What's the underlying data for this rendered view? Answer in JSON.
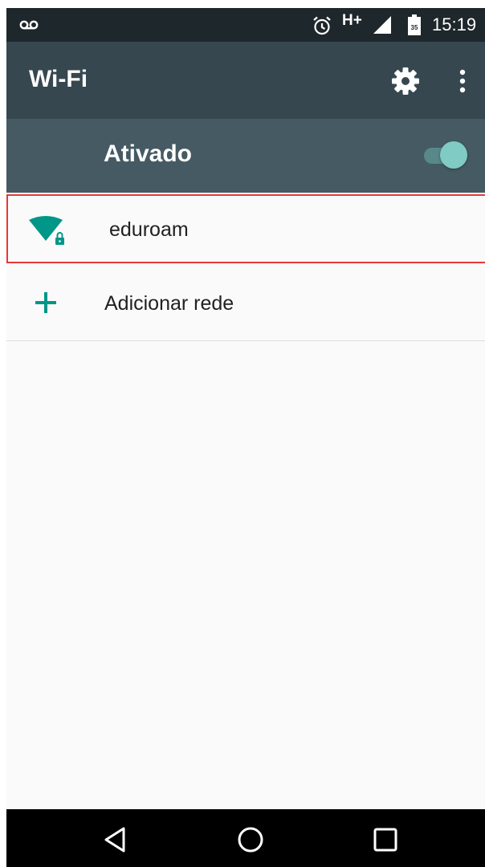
{
  "status_bar": {
    "network": "H+",
    "battery_level": "35",
    "time": "15:19",
    "icons": [
      "voicemail-icon",
      "alarm-icon",
      "signal-icon",
      "battery-icon"
    ]
  },
  "app_bar": {
    "title": "Wi-Fi",
    "icons": [
      "gear-icon",
      "more-vert-icon"
    ]
  },
  "wifi_switch": {
    "label": "Ativado",
    "on": true
  },
  "networks": [
    {
      "name": "eduroam",
      "icon": "wifi-lock-icon",
      "secured": true
    }
  ],
  "add_network": {
    "label": "Adicionar rede",
    "icon": "plus-icon"
  },
  "colors": {
    "status_bar": "#1e272b",
    "app_bar": "#37474f",
    "switch_bar": "#455a63",
    "accent": "#009688",
    "toggle_thumb": "#80cbc4",
    "highlight": "#e53935"
  },
  "nav_bar": {
    "icons": [
      "back-icon",
      "home-icon",
      "recents-icon"
    ]
  }
}
